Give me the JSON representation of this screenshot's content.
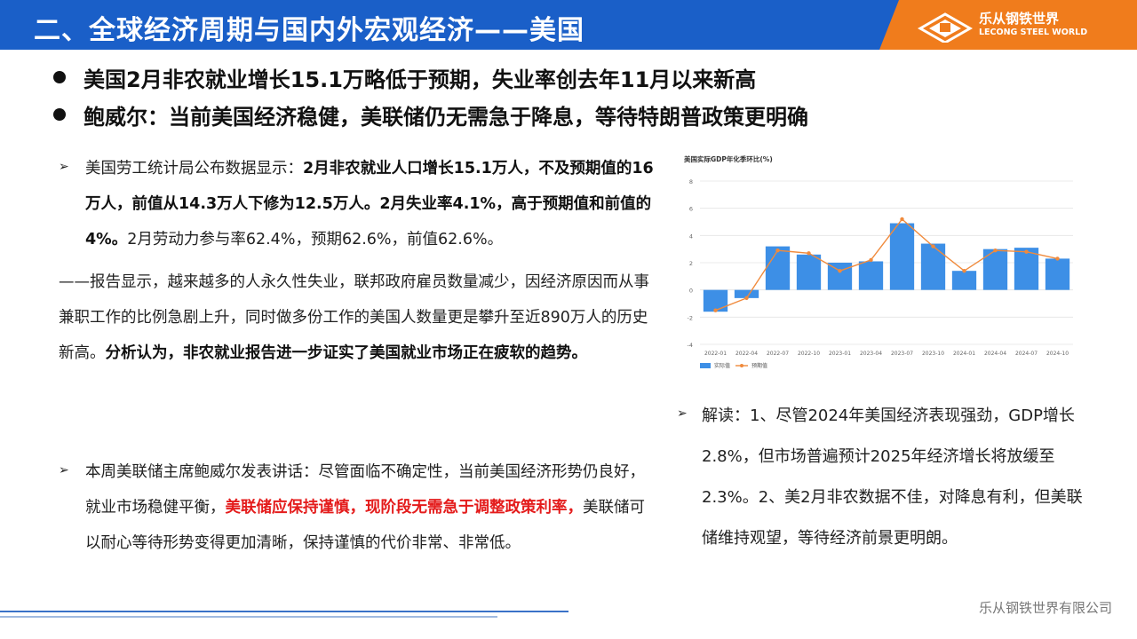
{
  "header": {
    "title": "二、全球经济周期与国内外宏观经济——美国",
    "logo_cn": "乐从钢铁世界",
    "logo_en": "LECONG STEEL WORLD"
  },
  "bullets": [
    "美国2月非农就业增长15.1万略低于预期，失业率创去年11月以来新高",
    "鲍威尔：当前美国经济稳健，美联储仍无需急于降息，等待特朗普政策更明确"
  ],
  "section1": {
    "arrow": "➢",
    "lead": "美国劳工统计局公布数据显示：",
    "bold1": "2月非农就业人口增长15.1万人，不及预期值的16万人，前值从14.3万人下修为12.5万人。2月失业率4.1%，高于预期值和前值的4%。",
    "tail": "2月劳动力参与率62.4%，预期62.6%，前值62.6%。",
    "report": "——报告显示，越来越多的人永久性失业，联邦政府雇员数量减少，因经济原因而从事兼职工作的比例急剧上升，同时做多份工作的美国人数量更是攀升至近890万人的历史新高。",
    "analysis": "分析认为，非农就业报告进一步证实了美国就业市场正在疲软的趋势。"
  },
  "section2": {
    "arrow": "➢",
    "lead": "本周美联储主席鲍威尔发表讲话：尽管面临不确定性，当前美国经济形势仍良好，就业市场稳健平衡，",
    "red": "美联储应保持谨慎，现阶段无需急于调整政策利率，",
    "tail": "美联储可以耐心等待形势变得更加清晰，保持谨慎的代价非常、非常低。"
  },
  "reading": {
    "arrow": "➢",
    "text": "解读：1、尽管2024年美国经济表现强劲，GDP增长2.8%，但市场普遍预计2025年经济增长将放缓至2.3%。2、美2月非农数据不佳，对降息有利，但美联储维持观望，等待经济前景更明朗。"
  },
  "footer": {
    "company": "乐从钢铁世界有限公司"
  },
  "colors": {
    "header_blue": "#1a5fc8",
    "header_orange": "#f07c1c",
    "bar_blue": "#3d8fe6",
    "line_orange": "#f08a3c",
    "highlight_red": "#e41c1c"
  },
  "chart_data": {
    "type": "bar",
    "title": "美国实际GDP年化季环比(%)",
    "categories": [
      "2022-01",
      "2022-04",
      "2022-07",
      "2022-10",
      "2023-01",
      "2023-04",
      "2023-07",
      "2023-10",
      "2024-01",
      "2024-04",
      "2024-07",
      "2024-10"
    ],
    "series": [
      {
        "name": "实际值",
        "type": "bar",
        "values": [
          -1.6,
          -0.6,
          3.2,
          2.6,
          2.0,
          2.1,
          4.9,
          3.4,
          1.4,
          3.0,
          3.1,
          2.3
        ]
      },
      {
        "name": "预期值",
        "type": "line",
        "values": [
          -1.5,
          -0.6,
          2.9,
          2.7,
          1.4,
          2.2,
          5.2,
          3.2,
          1.4,
          2.9,
          2.8,
          2.3
        ]
      }
    ],
    "y_ticks": [
      "-4",
      "-2",
      "0",
      "2",
      "4",
      "6",
      "8"
    ],
    "ylim": [
      -4,
      8
    ],
    "grid": true,
    "legend": "bottom-left"
  }
}
